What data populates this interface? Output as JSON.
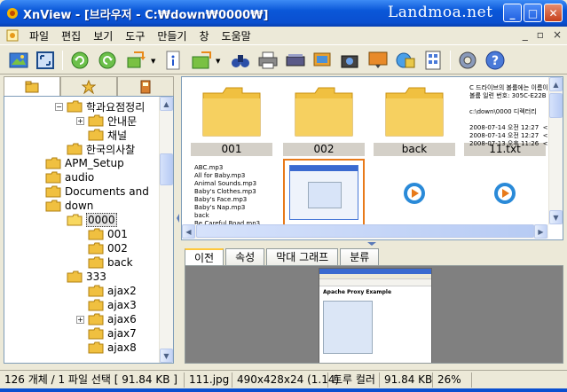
{
  "window": {
    "title": "XnView - [브라우저 - C:₩down₩0000₩]",
    "watermark": "Landmoa.net",
    "controls": {
      "minimize": "_",
      "maximize": "□",
      "close": "✕"
    },
    "accent": "#0a57d8"
  },
  "menu": {
    "items": [
      "파일",
      "편집",
      "보기",
      "도구",
      "만들기",
      "창",
      "도움말"
    ],
    "mdi_controls": [
      "_",
      "▫",
      "×"
    ]
  },
  "toolbar": {
    "icons": [
      "open-folder-icon",
      "fullscreen-icon",
      "refresh-back-icon",
      "refresh-forward-icon",
      "convert-icon",
      "info-icon",
      "export-icon",
      "binoculars-icon",
      "print-icon",
      "scanner-icon",
      "slideshow-icon",
      "camera-icon",
      "wallpaper-icon",
      "web-page-icon",
      "contact-sheet-icon",
      "settings-icon",
      "help-icon"
    ]
  },
  "left_tabs": [
    "folders-tab-icon",
    "favorites-tab-icon",
    "categories-tab-icon"
  ],
  "tree": {
    "items": [
      {
        "label": "학과요점정리",
        "expander": "−",
        "level": 2
      },
      {
        "label": "안내문",
        "expander": "+",
        "level": 3
      },
      {
        "label": "채널",
        "expander": "",
        "level": 3
      },
      {
        "label": "한국의사찰",
        "expander": "",
        "level": 2
      },
      {
        "label": "APM_Setup",
        "expander": "",
        "level": 1
      },
      {
        "label": "audio",
        "expander": "",
        "level": 1
      },
      {
        "label": "Documents and",
        "expander": "",
        "level": 1
      },
      {
        "label": "down",
        "expander": "",
        "level": 1
      },
      {
        "label": "0000",
        "expander": "",
        "level": 2,
        "selected": true
      },
      {
        "label": "001",
        "expander": "",
        "level": 3
      },
      {
        "label": "002",
        "expander": "",
        "level": 3
      },
      {
        "label": "back",
        "expander": "",
        "level": 3
      },
      {
        "label": "333",
        "expander": "",
        "level": 2
      },
      {
        "label": "ajax2",
        "expander": "",
        "level": 3
      },
      {
        "label": "ajax3",
        "expander": "",
        "level": 3
      },
      {
        "label": "ajax6",
        "expander": "+",
        "level": 3
      },
      {
        "label": "ajax7",
        "expander": "",
        "level": 3
      },
      {
        "label": "ajax8",
        "expander": "",
        "level": 3
      }
    ]
  },
  "browser": {
    "thumbnails": [
      {
        "caption": "001",
        "kind": "folder"
      },
      {
        "caption": "002",
        "kind": "folder"
      },
      {
        "caption": "back",
        "kind": "folder"
      },
      {
        "caption": "11.txt",
        "kind": "text"
      },
      {
        "caption": "",
        "kind": "playlist"
      },
      {
        "caption": "",
        "kind": "image",
        "selected": true
      },
      {
        "caption": "",
        "kind": "media"
      },
      {
        "caption": "",
        "kind": "media"
      }
    ],
    "txt_preview": "C 드라이브의 볼륨에는 이름이\n볼륨 일련 번호: 305C-E22B\n\nc:\\down\\0000 디렉터리\n\n2008-07-14 오전 12:27  <DIR\n2008-07-14 오전 12:27  <DIR\n2008-07-13 오후 11:26  <DIR",
    "playlist_preview": "ABC.mp3\nAll for Baby.mp3\nAnimal Sounds.mp3\nBaby's Clothes.mp3\nBaby's Face.mp3\nBaby's Nap.mp3\nback\nBe Careful Road.mp3"
  },
  "preview_tabs": [
    "이전",
    "속성",
    "막대 그래프",
    "분류"
  ],
  "preview": {
    "page_title": "Apache Proxy Example"
  },
  "status": {
    "items": [
      "126 개체 / 1 파일 선택  [ 91.84 KB ]",
      "111.jpg",
      "490x428x24 (1.14)",
      "트루 컬러",
      "91.84 KB",
      "26%"
    ]
  }
}
